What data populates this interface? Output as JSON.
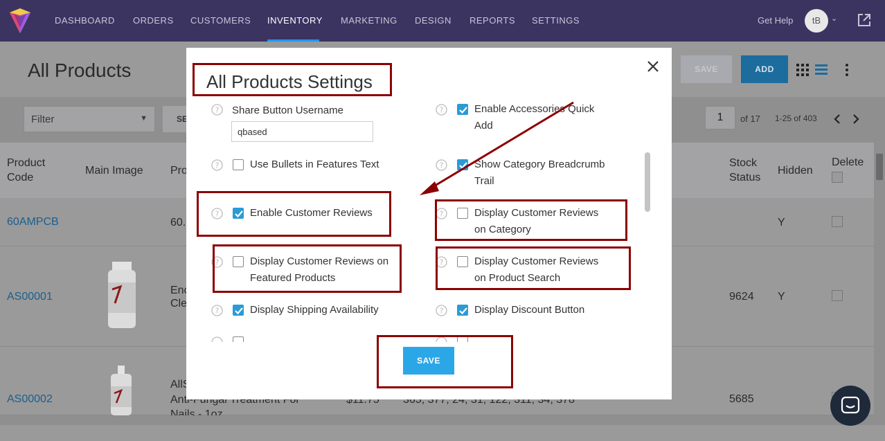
{
  "nav": {
    "items": [
      "DASHBOARD",
      "ORDERS",
      "CUSTOMERS",
      "INVENTORY",
      "MARKETING",
      "DESIGN",
      "REPORTS",
      "SETTINGS"
    ],
    "active": "INVENTORY",
    "get_help": "Get Help",
    "avatar_initials": "tB"
  },
  "page": {
    "title": "All Products",
    "save_label": "SAVE",
    "add_label": "ADD",
    "filter_placeholder": "Filter",
    "search_label_partial": "SE",
    "page_number": "1",
    "of_pages": "of 17",
    "range": "1-25 of 403"
  },
  "table": {
    "headers": {
      "code": [
        "Product",
        "Code"
      ],
      "image": "Main Image",
      "product_partial": "Pro",
      "stock": [
        "Stock",
        "Status"
      ],
      "hidden": "Hidden",
      "delete": "Delete"
    },
    "rows": [
      {
        "code": "60AMPCB",
        "name": [
          "60."
        ],
        "price": "",
        "categories": "",
        "stock": "",
        "hidden": "Y"
      },
      {
        "code": "AS00001",
        "name": [
          "Enc",
          "Cle"
        ],
        "price": "",
        "categories": "",
        "stock": "9624",
        "hidden": "Y"
      },
      {
        "code": "AS00002",
        "name": [
          "AllS",
          "Anti-Fungal Treatment For",
          "Nails - 1oz"
        ],
        "price": "$11.75",
        "categories": "365, 377, 24, 31, 122, 311, 34, 378",
        "stock": "5685",
        "hidden": ""
      }
    ]
  },
  "modal": {
    "title": "All Products Settings",
    "save_label": "SAVE",
    "share_username_label": "Share Button Username",
    "share_username_value": "qbased",
    "left": [
      {
        "label": "Use Bullets in Features Text",
        "checked": false
      },
      {
        "label": "Enable Customer Reviews",
        "checked": true
      },
      {
        "label": [
          "Display Customer Reviews on",
          "Featured Products"
        ],
        "checked": false
      },
      {
        "label": "Display Shipping Availability",
        "checked": true
      }
    ],
    "right": [
      {
        "label": [
          "Enable Accessories Quick",
          "Add"
        ],
        "checked": true
      },
      {
        "label": [
          "Show Category Breadcrumb",
          "Trail"
        ],
        "checked": true
      },
      {
        "label": [
          "Display Customer Reviews",
          "on Category"
        ],
        "checked": false
      },
      {
        "label": [
          "Display Customer Reviews",
          "on Product Search"
        ],
        "checked": false
      },
      {
        "label": "Display Discount Button",
        "checked": true
      }
    ]
  },
  "colors": {
    "nav_bg": "#3b3461",
    "accent": "#2b9bd6",
    "annotation": "#8b0000"
  }
}
